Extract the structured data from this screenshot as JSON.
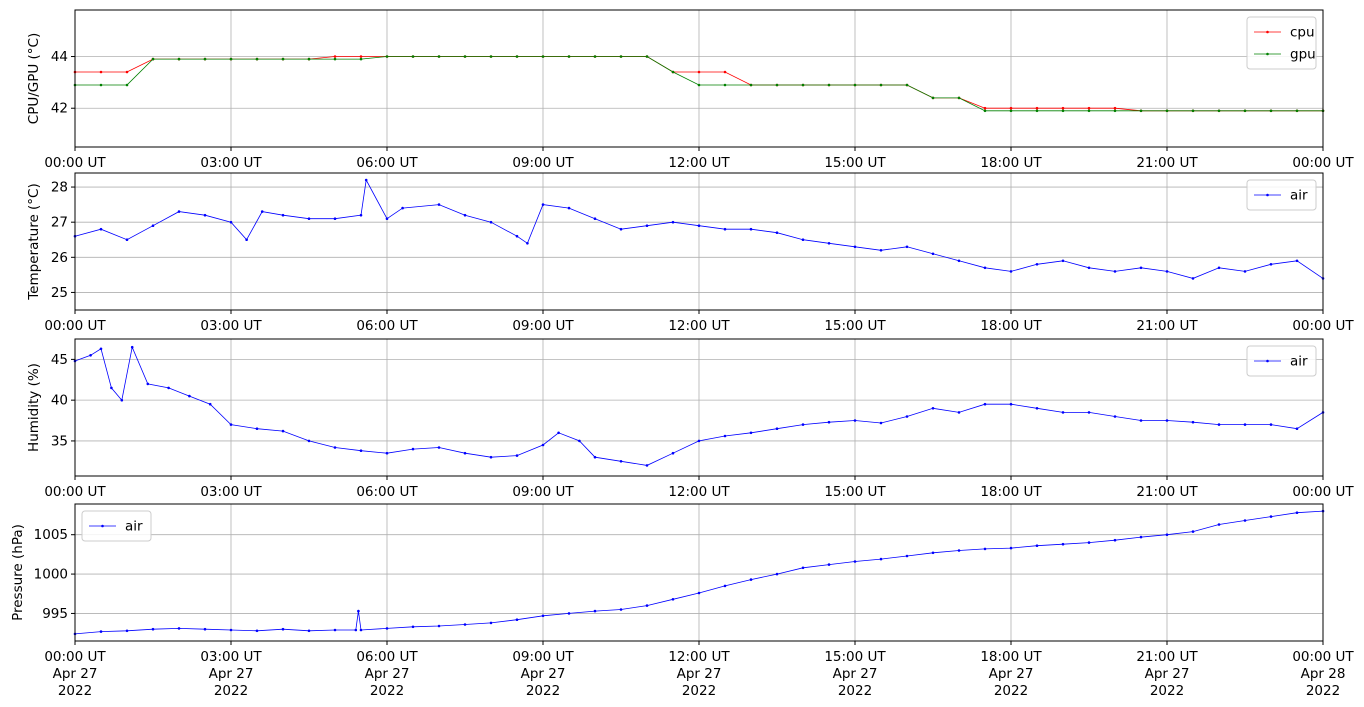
{
  "chart_data": [
    {
      "type": "line",
      "ylabel": "CPU/GPU (°C)",
      "ylim": [
        40.5,
        45.8
      ],
      "yticks": [
        42,
        44
      ],
      "grid": true,
      "legend_position": "top-right",
      "xticks": [
        "00:00 UT",
        "03:00 UT",
        "06:00 UT",
        "09:00 UT",
        "12:00 UT",
        "15:00 UT",
        "18:00 UT",
        "21:00 UT",
        "00:00 UT"
      ],
      "series": [
        {
          "name": "cpu",
          "color": "#ff0000",
          "x_hours": [
            0,
            0.5,
            1.0,
            1.5,
            2.0,
            2.5,
            3.0,
            3.5,
            4.0,
            4.5,
            5.0,
            5.5,
            6.0,
            6.5,
            7.0,
            7.5,
            8.0,
            8.5,
            9.0,
            9.5,
            10.0,
            10.5,
            11.0,
            11.5,
            12.0,
            12.5,
            13.0,
            13.5,
            14.0,
            14.5,
            15.0,
            15.5,
            16.0,
            16.5,
            17.0,
            17.5,
            18.0,
            18.5,
            19.0,
            19.5,
            20.0,
            20.5,
            21.0,
            21.5,
            22.0,
            22.5,
            23.0,
            23.5,
            24.0
          ],
          "values": [
            43.4,
            43.4,
            43.4,
            43.9,
            43.9,
            43.9,
            43.9,
            43.9,
            43.9,
            43.9,
            44.0,
            44.0,
            44.0,
            44.0,
            44.0,
            44.0,
            44.0,
            44.0,
            44.0,
            44.0,
            44.0,
            44.0,
            44.0,
            43.4,
            43.4,
            43.4,
            42.9,
            42.9,
            42.9,
            42.9,
            42.9,
            42.9,
            42.9,
            42.4,
            42.4,
            42.0,
            42.0,
            42.0,
            42.0,
            42.0,
            42.0,
            41.9,
            41.9,
            41.9,
            41.9,
            41.9,
            41.9,
            41.9,
            41.9
          ]
        },
        {
          "name": "gpu",
          "color": "#008000",
          "x_hours": [
            0,
            0.5,
            1.0,
            1.5,
            2.0,
            2.5,
            3.0,
            3.5,
            4.0,
            4.5,
            5.0,
            5.5,
            6.0,
            6.5,
            7.0,
            7.5,
            8.0,
            8.5,
            9.0,
            9.5,
            10.0,
            10.5,
            11.0,
            11.5,
            12.0,
            12.5,
            13.0,
            13.5,
            14.0,
            14.5,
            15.0,
            15.5,
            16.0,
            16.5,
            17.0,
            17.5,
            18.0,
            18.5,
            19.0,
            19.5,
            20.0,
            20.5,
            21.0,
            21.5,
            22.0,
            22.5,
            23.0,
            23.5,
            24.0
          ],
          "values": [
            42.9,
            42.9,
            42.9,
            43.9,
            43.9,
            43.9,
            43.9,
            43.9,
            43.9,
            43.9,
            43.9,
            43.9,
            44.0,
            44.0,
            44.0,
            44.0,
            44.0,
            44.0,
            44.0,
            44.0,
            44.0,
            44.0,
            44.0,
            43.4,
            42.9,
            42.9,
            42.9,
            42.9,
            42.9,
            42.9,
            42.9,
            42.9,
            42.9,
            42.4,
            42.4,
            41.9,
            41.9,
            41.9,
            41.9,
            41.9,
            41.9,
            41.9,
            41.9,
            41.9,
            41.9,
            41.9,
            41.9,
            41.9,
            41.9
          ]
        }
      ]
    },
    {
      "type": "line",
      "ylabel": "Temperature (°C)",
      "ylim": [
        24.5,
        28.4
      ],
      "yticks": [
        25,
        26,
        27,
        28
      ],
      "grid": true,
      "legend_position": "top-right",
      "xticks": [
        "00:00 UT",
        "03:00 UT",
        "06:00 UT",
        "09:00 UT",
        "12:00 UT",
        "15:00 UT",
        "18:00 UT",
        "21:00 UT",
        "00:00 UT"
      ],
      "series": [
        {
          "name": "air",
          "color": "#0000ff",
          "x_hours": [
            0,
            0.5,
            1.0,
            1.5,
            2.0,
            2.5,
            3.0,
            3.3,
            3.6,
            4.0,
            4.5,
            5.0,
            5.5,
            5.6,
            6.0,
            6.3,
            7.0,
            7.5,
            8.0,
            8.5,
            8.7,
            9.0,
            9.5,
            10.0,
            10.5,
            11.0,
            11.5,
            12.0,
            12.5,
            13.0,
            13.5,
            14.0,
            14.5,
            15.0,
            15.5,
            16.0,
            16.5,
            17.0,
            17.5,
            18.0,
            18.5,
            19.0,
            19.5,
            20.0,
            20.5,
            21.0,
            21.5,
            22.0,
            22.5,
            23.0,
            23.5,
            24.0
          ],
          "values": [
            26.6,
            26.8,
            26.5,
            26.9,
            27.3,
            27.2,
            27.0,
            26.5,
            27.3,
            27.2,
            27.1,
            27.1,
            27.2,
            28.2,
            27.1,
            27.4,
            27.5,
            27.2,
            27.0,
            26.6,
            26.4,
            27.5,
            27.4,
            27.1,
            26.8,
            26.9,
            27.0,
            26.9,
            26.8,
            26.8,
            26.7,
            26.5,
            26.4,
            26.3,
            26.2,
            26.3,
            26.1,
            25.9,
            25.7,
            25.6,
            25.8,
            25.9,
            25.7,
            25.6,
            25.7,
            25.6,
            25.4,
            25.7,
            25.6,
            25.8,
            25.9,
            25.4
          ]
        }
      ]
    },
    {
      "type": "line",
      "ylabel": "Humidity (%)",
      "ylim": [
        30.7,
        47.5
      ],
      "yticks": [
        35,
        40,
        45
      ],
      "grid": true,
      "legend_position": "top-right",
      "xticks": [
        "00:00 UT",
        "03:00 UT",
        "06:00 UT",
        "09:00 UT",
        "12:00 UT",
        "15:00 UT",
        "18:00 UT",
        "21:00 UT",
        "00:00 UT"
      ],
      "series": [
        {
          "name": "air",
          "color": "#0000ff",
          "x_hours": [
            0,
            0.3,
            0.5,
            0.7,
            0.9,
            1.1,
            1.4,
            1.8,
            2.2,
            2.6,
            3.0,
            3.5,
            4.0,
            4.5,
            5.0,
            5.5,
            6.0,
            6.5,
            7.0,
            7.5,
            8.0,
            8.5,
            9.0,
            9.3,
            9.7,
            10.0,
            10.5,
            11.0,
            11.5,
            12.0,
            12.5,
            13.0,
            13.5,
            14.0,
            14.5,
            15.0,
            15.5,
            16.0,
            16.5,
            17.0,
            17.5,
            18.0,
            18.5,
            19.0,
            19.5,
            20.0,
            20.5,
            21.0,
            21.5,
            22.0,
            22.5,
            23.0,
            23.5,
            24.0
          ],
          "values": [
            44.8,
            45.5,
            46.3,
            41.5,
            40.0,
            46.5,
            42.0,
            41.5,
            40.5,
            39.5,
            37.0,
            36.5,
            36.2,
            35.0,
            34.2,
            33.8,
            33.5,
            34.0,
            34.2,
            33.5,
            33.0,
            33.2,
            34.5,
            36.0,
            35.0,
            33.0,
            32.5,
            32.0,
            33.5,
            35.0,
            35.6,
            36.0,
            36.5,
            37.0,
            37.3,
            37.5,
            37.2,
            38.0,
            39.0,
            38.5,
            39.5,
            39.5,
            39.0,
            38.5,
            38.5,
            38.0,
            37.5,
            37.5,
            37.3,
            37.0,
            37.0,
            37.0,
            36.5,
            38.5
          ]
        }
      ]
    },
    {
      "type": "line",
      "ylabel": "Pressure (hPa)",
      "ylim": [
        991.5,
        1008.9
      ],
      "yticks": [
        995,
        1000,
        1005
      ],
      "grid": true,
      "legend_position": "top-left",
      "xticks": [
        "00:00 UT",
        "03:00 UT",
        "06:00 UT",
        "09:00 UT",
        "12:00 UT",
        "15:00 UT",
        "18:00 UT",
        "21:00 UT",
        "00:00 UT"
      ],
      "xtick_lines": [
        [
          "00:00 UT",
          "Apr 27",
          "2022"
        ],
        [
          "03:00 UT",
          "Apr 27",
          "2022"
        ],
        [
          "06:00 UT",
          "Apr 27",
          "2022"
        ],
        [
          "09:00 UT",
          "Apr 27",
          "2022"
        ],
        [
          "12:00 UT",
          "Apr 27",
          "2022"
        ],
        [
          "15:00 UT",
          "Apr 27",
          "2022"
        ],
        [
          "18:00 UT",
          "Apr 27",
          "2022"
        ],
        [
          "21:00 UT",
          "Apr 27",
          "2022"
        ],
        [
          "00:00 UT",
          "Apr 28",
          "2022"
        ]
      ],
      "series": [
        {
          "name": "air",
          "color": "#0000ff",
          "x_hours": [
            0,
            0.5,
            1.0,
            1.5,
            2.0,
            2.5,
            3.0,
            3.5,
            4.0,
            4.5,
            5.0,
            5.4,
            5.45,
            5.5,
            6.0,
            6.5,
            7.0,
            7.5,
            8.0,
            8.5,
            9.0,
            9.5,
            10.0,
            10.5,
            11.0,
            11.5,
            12.0,
            12.5,
            13.0,
            13.5,
            14.0,
            14.5,
            15.0,
            15.5,
            16.0,
            16.5,
            17.0,
            17.5,
            18.0,
            18.5,
            19.0,
            19.5,
            20.0,
            20.5,
            21.0,
            21.5,
            22.0,
            22.5,
            23.0,
            23.5,
            24.0
          ],
          "values": [
            992.4,
            992.7,
            992.8,
            993.0,
            993.1,
            993.0,
            992.9,
            992.8,
            993.0,
            992.8,
            992.9,
            992.9,
            995.3,
            992.9,
            993.1,
            993.3,
            993.4,
            993.6,
            993.8,
            994.2,
            994.7,
            995.0,
            995.3,
            995.5,
            996.0,
            996.8,
            997.6,
            998.5,
            999.3,
            1000.0,
            1000.8,
            1001.2,
            1001.6,
            1001.9,
            1002.3,
            1002.7,
            1003.0,
            1003.2,
            1003.3,
            1003.6,
            1003.8,
            1004.0,
            1004.3,
            1004.7,
            1005.0,
            1005.4,
            1006.3,
            1006.8,
            1007.3,
            1007.8,
            1008.0
          ]
        }
      ]
    }
  ]
}
